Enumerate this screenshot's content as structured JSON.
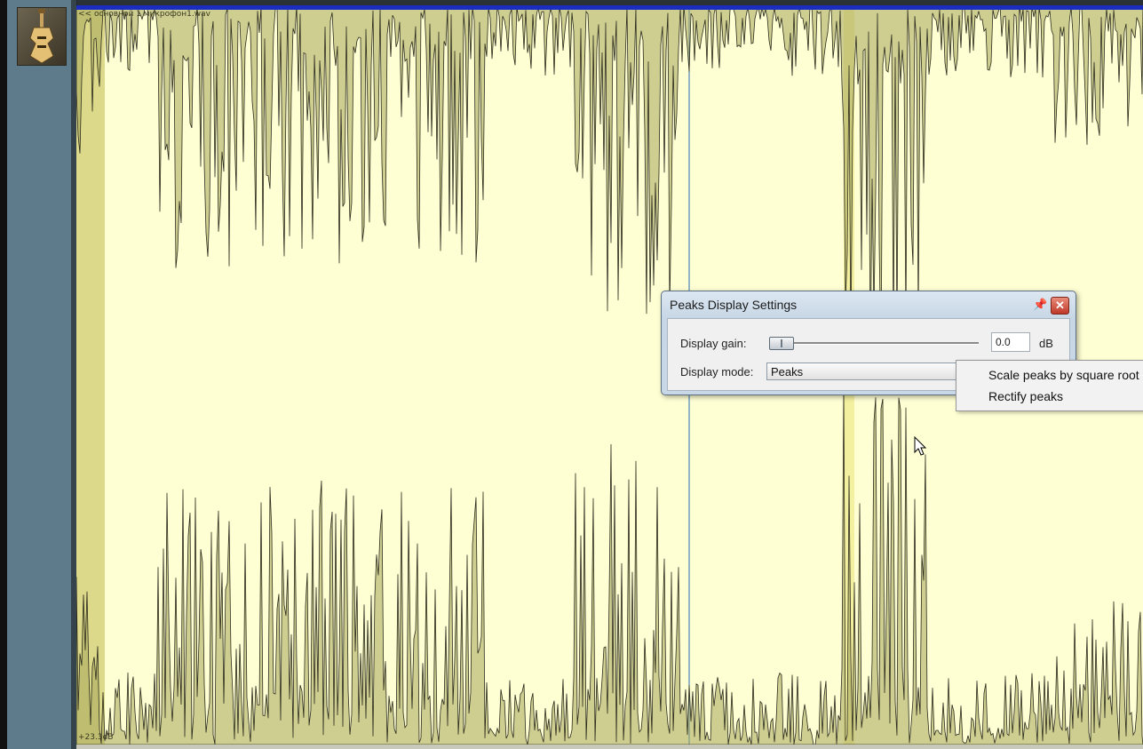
{
  "clip": {
    "name": "<< основной 1 микрофон1.wav",
    "gain_badge": "+23.3dB"
  },
  "dialog": {
    "title": "Peaks Display Settings",
    "gain_label": "Display gain:",
    "gain_value": "0.0",
    "gain_unit": "dB",
    "mode_label": "Display mode:",
    "mode_value": "Peaks"
  },
  "menu": {
    "items": [
      "Scale peaks by square root",
      "Rectify peaks"
    ]
  },
  "colors": {
    "clip_background": "#ffffd4",
    "waveform_fill": "#a6a65a",
    "waveform_line": "#2c2c1e",
    "clip_header": "#1b2dbf",
    "track_header": "#5e7b8b"
  },
  "icons": [
    "guitar-icon",
    "pin-icon",
    "close-icon",
    "chevron-down-icon",
    "cursor-icon"
  ]
}
